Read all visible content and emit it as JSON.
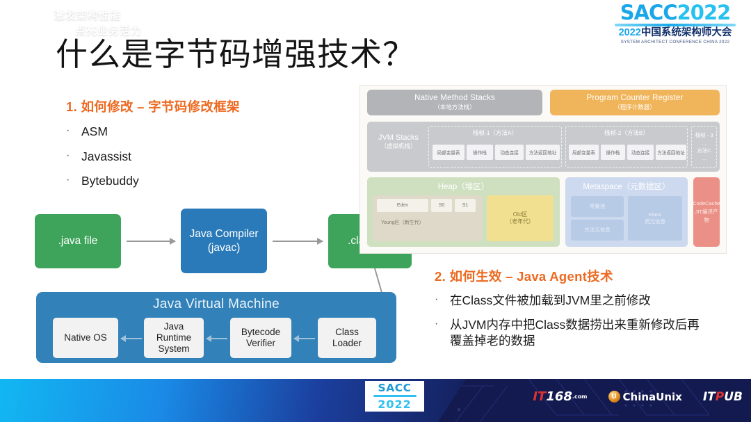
{
  "header": {
    "logo_main": "SACC",
    "logo_year": "2022",
    "logo_cn_year": "2022",
    "logo_cn": "中国系统架构师大会",
    "logo_en": "SYSTEM ARCHITECT CONFERENCE CHINA 2022"
  },
  "title": "什么是字节码增强技术？",
  "section1": {
    "heading": "1. 如何修改 – 字节码修改框架",
    "bullet_char": "·",
    "bullets": [
      "ASM",
      "Javassist",
      "Bytebuddy"
    ]
  },
  "section2": {
    "heading": "2. 如何生效 – Java Agent技术",
    "bullet_char": "·",
    "bullets": [
      "在Class文件被加载到JVM里之前修改",
      "从JVM内存中把Class数据捞出来重新修改后再覆盖掉老的数据"
    ]
  },
  "compile_diagram": {
    "java_file": ".java file",
    "compiler": "Java Compiler\n(javac)",
    "compiler_l1": "Java Compiler",
    "compiler_l2": "(javac)",
    "class_file": ".class file",
    "jvm_title": "Java Virtual Machine",
    "jvm_cells": [
      "Native OS",
      "Java\nRuntime\nSystem",
      "Bytecode\nVerifier",
      "Class\nLoader"
    ],
    "native_os": "Native OS",
    "runtime_l1": "Java",
    "runtime_l2": "Runtime",
    "runtime_l3": "System",
    "verifier_l1": "Bytecode",
    "verifier_l2": "Verifier",
    "loader_l1": "Class",
    "loader_l2": "Loader"
  },
  "memory_diagram": {
    "native_method_stacks_en": "Native Method Stacks",
    "native_method_stacks_cn": "（本地方法栈）",
    "pc_register_en": "Program Counter Register",
    "pc_register_cn": "（程序计数器）",
    "jvm_stacks_en": "JVM Stacks",
    "jvm_stacks_cn": "（虚拟机栈）",
    "frame1_title": "栈帧-1（方法A）",
    "frame2_title": "栈帧-2（方法B）",
    "frame3_l1": "栈帧 - 3",
    "frame3_l2": "…",
    "frame3_l3": "方法C",
    "frame3_l4": "…",
    "frame_slots": [
      "局部变量表",
      "操作栈",
      "动态连接",
      "方法返回地址"
    ],
    "heap_en": "Heap",
    "heap_cn": "（堆区）",
    "eden": "Eden",
    "s0": "S0",
    "s1": "S1",
    "young_label": "Young区（新生代）",
    "old_l1": "Old区",
    "old_l2": "（老年代）",
    "metaspace_en": "Metaspace",
    "metaspace_cn": "（元数据区）",
    "meta_cells": [
      "常量池",
      "方法元信息"
    ],
    "meta_klass_l1": "Klass",
    "meta_klass_l2": "类元信息",
    "codecache_l1": "CodeCache",
    "codecache_l2": "JIT编译产物"
  },
  "footer": {
    "slogan_line1": "激发架构性能",
    "slogan_line2": "点亮业务活力",
    "badge_top": "SACC",
    "badge_bottom": "2022",
    "logo_it168_a": "IT",
    "logo_it168_b": "168",
    "logo_it168_c": ".com",
    "logo_chinaunix": "ChinaUnix",
    "logo_itpub_a": "IT",
    "logo_itpub_b": "P",
    "logo_itpub_c": "UB"
  },
  "colors": {
    "accent_orange": "#ec6a21",
    "brand_blue": "#1aa7e8",
    "green_node": "#3fa45b",
    "blue_node": "#2a7ab9",
    "jvm_box": "#3281b8",
    "footer_navy": "#131a4f"
  }
}
